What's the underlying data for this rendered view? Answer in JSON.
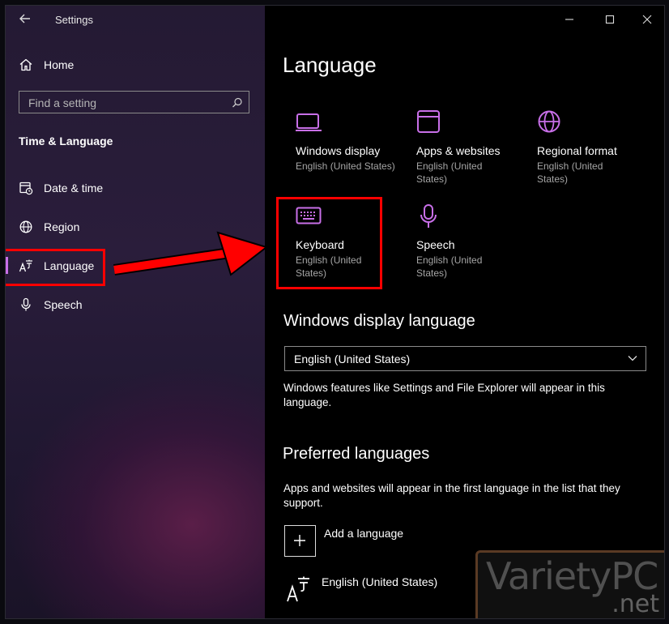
{
  "window": {
    "title": "Settings"
  },
  "sidebar": {
    "home_label": "Home",
    "search_placeholder": "Find a setting",
    "section_title": "Time & Language",
    "items": [
      {
        "label": "Date & time",
        "icon": "calendar-clock-icon"
      },
      {
        "label": "Region",
        "icon": "globe-icon"
      },
      {
        "label": "Language",
        "icon": "language-icon",
        "selected": true
      },
      {
        "label": "Speech",
        "icon": "microphone-icon"
      }
    ]
  },
  "main": {
    "title": "Language",
    "tiles": [
      {
        "title": "Windows display",
        "subtitle": "English (United States)",
        "icon": "monitor-icon"
      },
      {
        "title": "Apps & websites",
        "subtitle": "English (United States)",
        "icon": "app-window-icon"
      },
      {
        "title": "Regional format",
        "subtitle": "English (United States)",
        "icon": "globe-icon"
      },
      {
        "title": "Keyboard",
        "subtitle": "English (United States)",
        "icon": "keyboard-icon"
      },
      {
        "title": "Speech",
        "subtitle": "English (United States)",
        "icon": "microphone-icon"
      }
    ],
    "display_language": {
      "heading": "Windows display language",
      "selected": "English (United States)",
      "description": "Windows features like Settings and File Explorer will appear in this language."
    },
    "preferred": {
      "heading": "Preferred languages",
      "description": "Apps and websites will appear in the first language in the list that they support.",
      "add_label": "Add a language",
      "languages": [
        {
          "name": "English (United States)"
        }
      ]
    }
  },
  "watermark": {
    "text": "VarietyPC",
    "suffix": ".net"
  },
  "colors": {
    "accent": "#c86fe8",
    "highlight": "#ff0000"
  }
}
